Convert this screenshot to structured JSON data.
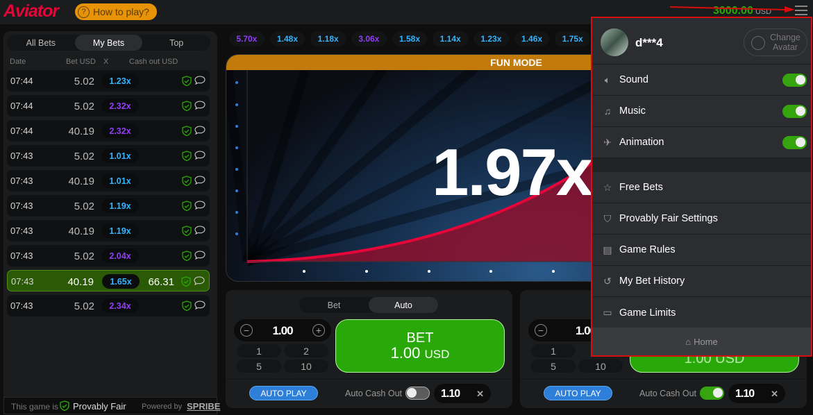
{
  "header": {
    "logo": "Aviator",
    "how_to_play": "How to play?",
    "balance": "3000.00",
    "currency": "USD"
  },
  "bets_panel": {
    "tabs": [
      "All Bets",
      "My Bets",
      "Top"
    ],
    "active_tab": "My Bets",
    "columns": [
      "Date",
      "Bet USD",
      "X",
      "Cash out USD"
    ],
    "rows": [
      {
        "time": "07:44",
        "bet": "5.02",
        "mult": "1.23x",
        "color": "#34b4ff",
        "cashout": "",
        "win": false
      },
      {
        "time": "07:44",
        "bet": "5.02",
        "mult": "2.32x",
        "color": "#913ef8",
        "cashout": "",
        "win": false
      },
      {
        "time": "07:44",
        "bet": "40.19",
        "mult": "2.32x",
        "color": "#913ef8",
        "cashout": "",
        "win": false
      },
      {
        "time": "07:43",
        "bet": "5.02",
        "mult": "1.01x",
        "color": "#34b4ff",
        "cashout": "",
        "win": false
      },
      {
        "time": "07:43",
        "bet": "40.19",
        "mult": "1.01x",
        "color": "#34b4ff",
        "cashout": "",
        "win": false
      },
      {
        "time": "07:43",
        "bet": "5.02",
        "mult": "1.19x",
        "color": "#34b4ff",
        "cashout": "",
        "win": false
      },
      {
        "time": "07:43",
        "bet": "40.19",
        "mult": "1.19x",
        "color": "#34b4ff",
        "cashout": "",
        "win": false
      },
      {
        "time": "07:43",
        "bet": "5.02",
        "mult": "2.04x",
        "color": "#913ef8",
        "cashout": "",
        "win": false
      },
      {
        "time": "07:43",
        "bet": "40.19",
        "mult": "1.65x",
        "color": "#34b4ff",
        "cashout": "66.31",
        "win": true
      },
      {
        "time": "07:43",
        "bet": "5.02",
        "mult": "2.34x",
        "color": "#913ef8",
        "cashout": "",
        "win": false
      }
    ],
    "footer": {
      "prefix": "This game is",
      "provably": "Provably Fair",
      "powered": "Powered by",
      "brand": "SPRIBE"
    }
  },
  "history": [
    {
      "v": "5.70x",
      "color": "#913ef8"
    },
    {
      "v": "1.48x",
      "color": "#34b4ff"
    },
    {
      "v": "1.18x",
      "color": "#34b4ff"
    },
    {
      "v": "3.06x",
      "color": "#913ef8"
    },
    {
      "v": "1.58x",
      "color": "#34b4ff"
    },
    {
      "v": "1.14x",
      "color": "#34b4ff"
    },
    {
      "v": "1.23x",
      "color": "#34b4ff"
    },
    {
      "v": "1.46x",
      "color": "#34b4ff"
    },
    {
      "v": "1.75x",
      "color": "#34b4ff"
    }
  ],
  "game": {
    "mode": "FUN MODE",
    "multiplier": "1.97x"
  },
  "bet_panels": [
    {
      "tabs": [
        "Bet",
        "Auto"
      ],
      "active": "Auto",
      "stake": "1.00",
      "quick": [
        "1",
        "2",
        "5",
        "10"
      ],
      "bet_label": "BET",
      "bet_amount": "1.00",
      "currency": "USD",
      "auto_play": "AUTO PLAY",
      "auto_cash_out": "Auto Cash Out",
      "auto_cash_out_on": false,
      "cash_out_value": "1.10"
    },
    {
      "stake": "1.00",
      "quick": [
        "1",
        "5",
        "10"
      ],
      "bet_amount_partial": "1.00 USD",
      "auto_play": "AUTO PLAY",
      "auto_cash_out": "Auto Cash Out",
      "auto_cash_out_on": true,
      "cash_out_value": "1.10"
    }
  ],
  "menu": {
    "username": "d***4",
    "change_avatar": "Change Avatar",
    "toggles": [
      {
        "label": "Sound",
        "icon": "speaker-icon",
        "on": true
      },
      {
        "label": "Music",
        "icon": "music-icon",
        "on": true
      },
      {
        "label": "Animation",
        "icon": "plane-icon",
        "on": true
      }
    ],
    "items": [
      {
        "label": "Free Bets",
        "icon": "star-icon"
      },
      {
        "label": "Provably Fair Settings",
        "icon": "shield-icon"
      },
      {
        "label": "Game Rules",
        "icon": "document-icon"
      },
      {
        "label": "My Bet History",
        "icon": "history-icon"
      },
      {
        "label": "Game Limits",
        "icon": "banknote-icon"
      }
    ],
    "home": "Home"
  }
}
